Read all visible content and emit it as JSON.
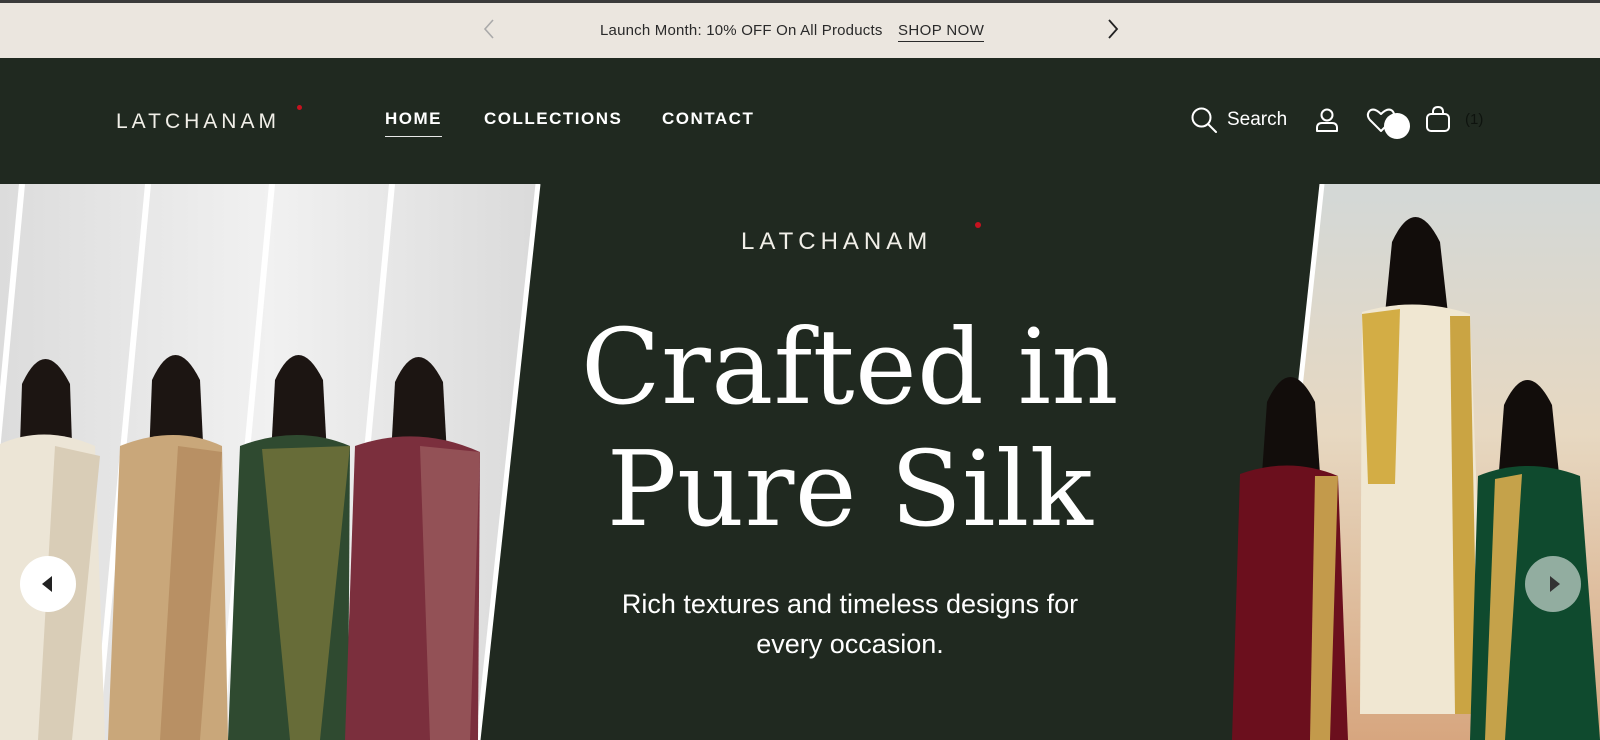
{
  "announcement": {
    "message": "Launch Month: 10% OFF On All Products",
    "cta": "SHOP NOW"
  },
  "header": {
    "brand": "LATCHANAM",
    "nav": {
      "home": "HOME",
      "collections": "COLLECTIONS",
      "contact": "CONTACT"
    },
    "search_label": "Search",
    "cart_count": "(1)"
  },
  "hero": {
    "brand": "LATCHANAM",
    "headline_line1": "Crafted in",
    "headline_line2": "Pure Silk",
    "subline_line1": "Rich textures and timeless designs for",
    "subline_line2": "every occasion."
  },
  "colors": {
    "header_bg": "#202920",
    "announcement_bg": "#ebe6df",
    "brand_dot": "#c6121f",
    "text_light": "#ffffff"
  },
  "icons": [
    "chevron-left-icon",
    "chevron-right-icon",
    "search-icon",
    "user-icon",
    "heart-icon",
    "bag-icon",
    "play-left-icon",
    "play-right-icon"
  ]
}
